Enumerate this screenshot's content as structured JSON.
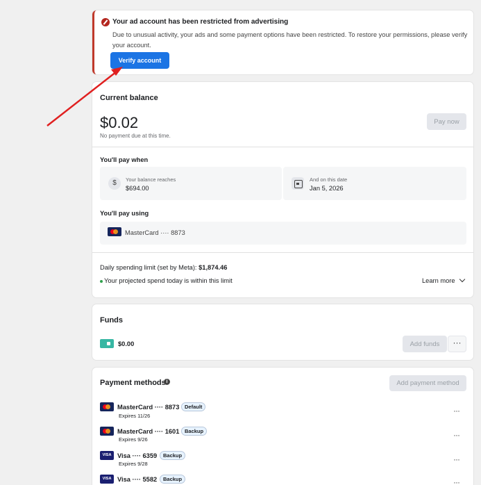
{
  "alert": {
    "title": "Your ad account has been restricted from advertising",
    "body": "Due to unusual activity, your ads and some payment options have been restricted. To restore your permissions, please verify your account.",
    "verify_label": "Verify account"
  },
  "balance": {
    "title": "Current balance",
    "amount": "$0.02",
    "note": "No payment due at this time.",
    "pay_now_label": "Pay now",
    "pay_when_title": "You'll pay when",
    "threshold_label": "Your balance reaches",
    "threshold_value": "$694.00",
    "date_label": "And on this date",
    "date_value": "Jan 5, 2026",
    "pay_using_title": "You'll pay using",
    "pay_using_card": "MasterCard ···· 8873",
    "limit_label": "Daily spending limit (set by Meta):",
    "limit_value": "$1,874.46",
    "projected_text": "Your projected spend today is within this limit",
    "learn_more_label": "Learn more"
  },
  "funds": {
    "title": "Funds",
    "value": "$0.00",
    "add_funds_label": "Add funds",
    "more_label": "···"
  },
  "methods": {
    "title": "Payment methods",
    "info_icon_glyph": "i",
    "add_label": "Add payment method",
    "items": [
      {
        "brand": "mastercard",
        "name": "MasterCard ···· 8873",
        "badge": "Default",
        "expires": "Expires 11/26",
        "more": "···"
      },
      {
        "brand": "mastercard",
        "name": "MasterCard ···· 1601",
        "badge": "Backup",
        "expires": "Expires 9/26",
        "more": "···"
      },
      {
        "brand": "visa",
        "name": "Visa ···· 6359",
        "badge": "Backup",
        "expires": "Expires 9/28",
        "more": "···"
      },
      {
        "brand": "visa",
        "name": "Visa ···· 5582",
        "badge": "Backup",
        "expires": "",
        "more": "···"
      }
    ],
    "visa_logo_text": "VISA"
  },
  "icons": {
    "dollar_glyph": "$"
  },
  "colors": {
    "accent": "#1b74e4",
    "error": "#b3261e",
    "arrow": "#e02020",
    "success": "#31a24c"
  }
}
